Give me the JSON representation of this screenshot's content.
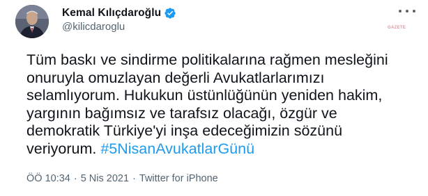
{
  "author": {
    "display_name": "Kemal Kılıçdaroğlu",
    "handle": "@kilicdaroglu",
    "verified": true,
    "avatar_icon": "profile-photo"
  },
  "watermark_text": "GAZETE",
  "tweet": {
    "lines": [
      "Tüm baskı ve sindirme politikalarına rağmen mesleğini",
      "onuruyla omuzlayan değerli Avukatlarlarımızı",
      "selamlıyorum. Hukukun üstünlüğünün yeniden hakim,",
      "yargının bağımsız ve tarafsız olacağı, özgür ve",
      "demokratik Türkiye'yi inşa edeceğimizin sözünü"
    ],
    "last_line_text": "veriyorum. ",
    "hashtag": "#5NisanAvukatlarGünü"
  },
  "meta": {
    "time": "ÖÖ 10:34",
    "separator": "·",
    "date": "5 Nis 2021",
    "source": "Twitter for iPhone"
  },
  "colors": {
    "text": "#0f1419",
    "secondary": "#536471",
    "link": "#1d9bf0",
    "verified_badge": "#1d9bf0"
  }
}
